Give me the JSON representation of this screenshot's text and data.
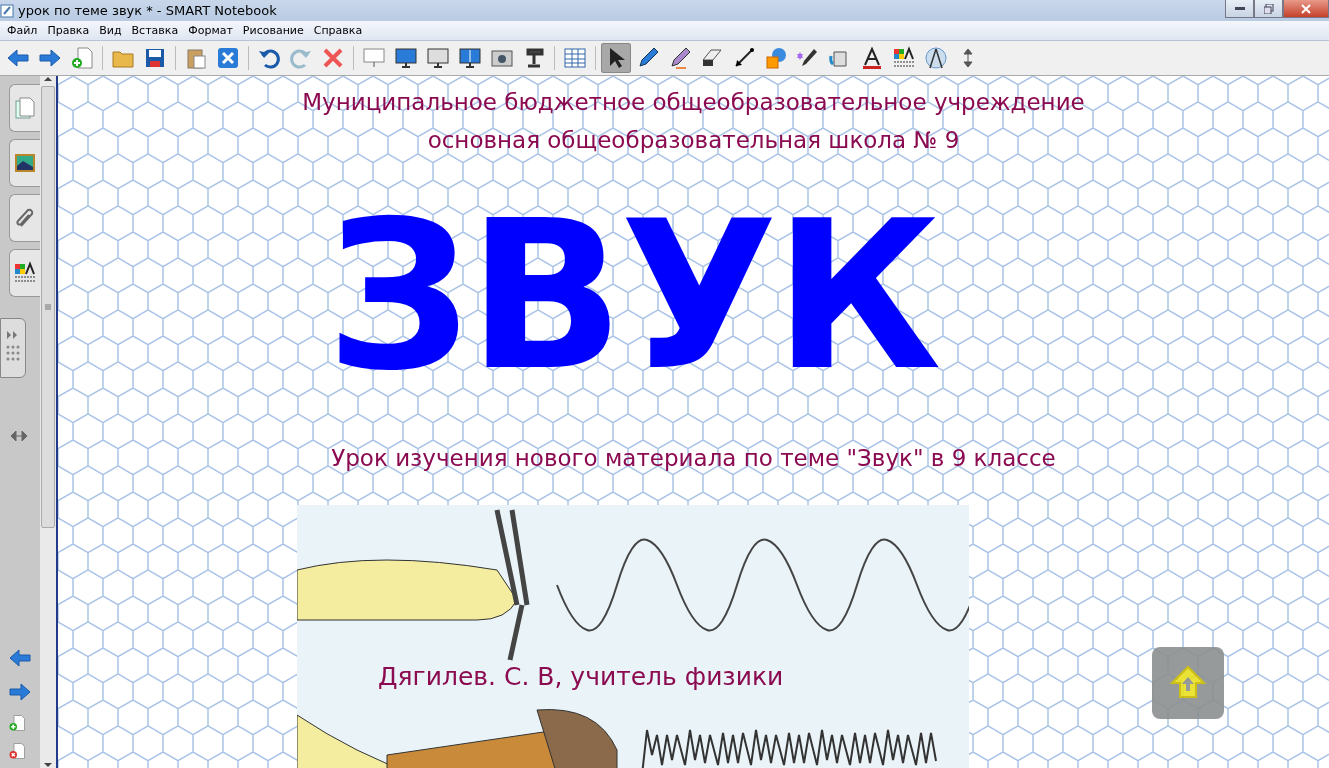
{
  "window": {
    "title": "урок по теме звук * - SMART Notebook"
  },
  "menu": [
    "Файл",
    "Правка",
    "Вид",
    "Вставка",
    "Формат",
    "Рисование",
    "Справка"
  ],
  "toolbar": [
    {
      "kind": "back",
      "selected": false
    },
    {
      "kind": "forward",
      "selected": false
    },
    {
      "kind": "addpage",
      "selected": false
    },
    {
      "kind": "sep"
    },
    {
      "kind": "open",
      "selected": false
    },
    {
      "kind": "save",
      "selected": false
    },
    {
      "kind": "sep"
    },
    {
      "kind": "paste",
      "selected": false
    },
    {
      "kind": "fullscreen",
      "selected": false
    },
    {
      "kind": "sep"
    },
    {
      "kind": "undo",
      "selected": false
    },
    {
      "kind": "redo",
      "selected": false
    },
    {
      "kind": "delete",
      "selected": false
    },
    {
      "kind": "sep"
    },
    {
      "kind": "shade",
      "selected": false
    },
    {
      "kind": "monitor",
      "selected": false
    },
    {
      "kind": "monitor2",
      "selected": false
    },
    {
      "kind": "dualview",
      "selected": false
    },
    {
      "kind": "camera",
      "selected": false
    },
    {
      "kind": "doccam",
      "selected": false
    },
    {
      "kind": "sep"
    },
    {
      "kind": "table",
      "selected": false
    },
    {
      "kind": "sep"
    },
    {
      "kind": "select",
      "selected": true
    },
    {
      "kind": "pen",
      "selected": false
    },
    {
      "kind": "creativepen",
      "selected": false
    },
    {
      "kind": "eraser",
      "selected": false
    },
    {
      "kind": "line",
      "selected": false
    },
    {
      "kind": "shapes",
      "selected": false
    },
    {
      "kind": "magicpen",
      "selected": false
    },
    {
      "kind": "fill",
      "selected": false
    },
    {
      "kind": "text",
      "selected": false
    },
    {
      "kind": "properties",
      "selected": false
    },
    {
      "kind": "measure",
      "selected": false
    },
    {
      "kind": "move",
      "selected": false
    }
  ],
  "side_tabs": [
    {
      "kind": "pages",
      "selected": false
    },
    {
      "kind": "gallery",
      "selected": false
    },
    {
      "kind": "attachments",
      "selected": false
    },
    {
      "kind": "properties",
      "selected": false
    }
  ],
  "slide": {
    "heading_lines": [
      "Муниципальное бюджетное общеобразовательное учреждение",
      "основная общеобразовательная школа № 9"
    ],
    "title": "ЗВУК",
    "subtitle": "Урок изучения нового материала по теме \"Звук\"  в 9 классе",
    "author": "Дягилев. С. В, учитель физики"
  }
}
